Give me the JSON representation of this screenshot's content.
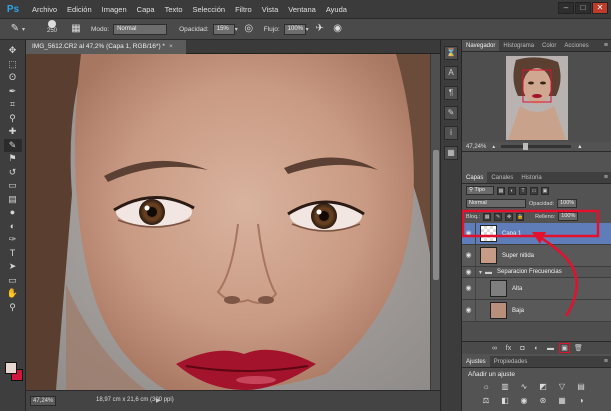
{
  "app": {
    "logo": "Ps"
  },
  "menu": {
    "items": [
      "Archivo",
      "Edición",
      "Imagen",
      "Capa",
      "Texto",
      "Selección",
      "Filtro",
      "Vista",
      "Ventana",
      "Ayuda"
    ]
  },
  "window_controls": {
    "minimize": "–",
    "maximize": "□",
    "close": "✕"
  },
  "options_bar": {
    "brush_size": "250",
    "mode_label": "Modo:",
    "mode_value": "Normal",
    "opacity_label": "Opacidad:",
    "opacity_value": "15%",
    "flow_label": "Flujo:",
    "flow_value": "100%"
  },
  "document": {
    "tab_title": "IMG_5612.CR2 al 47,2% (Capa 1, RGB/16*) *",
    "close": "×"
  },
  "status_bar": {
    "zoom": "47,24%",
    "info": "18,97 cm x 21,6 cm (300 ppi)",
    "arrow": "▶"
  },
  "panels": {
    "top_tabs": [
      "Navegador",
      "Histograma",
      "Color",
      "Acciones"
    ],
    "navigator_zoom": "47,24%",
    "layer_tabs": [
      "Capas",
      "Canales",
      "Historia"
    ],
    "kind_label": "Tipo",
    "blend_mode": "Normal",
    "opacity_label": "Opacidad:",
    "opacity_value": "100%",
    "lock_label": "Bloq.:",
    "fill_label": "Relleno:",
    "fill_value": "100%",
    "layers": [
      {
        "name": "Capa 1",
        "selected": true,
        "kind": "layer"
      },
      {
        "name": "Super nitida",
        "selected": false,
        "kind": "layer"
      },
      {
        "name": "Separacion Frecuencias",
        "selected": false,
        "kind": "group"
      },
      {
        "name": "Alta",
        "selected": false,
        "kind": "layer"
      },
      {
        "name": "Baja",
        "selected": false,
        "kind": "layer"
      }
    ],
    "adjust_tabs": [
      "Ajustes",
      "Propiedades"
    ],
    "adjust_title": "Añadir un ajuste"
  },
  "colors": {
    "foreground": "#e8d6d0",
    "background": "#d1153c",
    "selected_layer": "#5f7db8",
    "highlight_red": "#e2122e"
  }
}
